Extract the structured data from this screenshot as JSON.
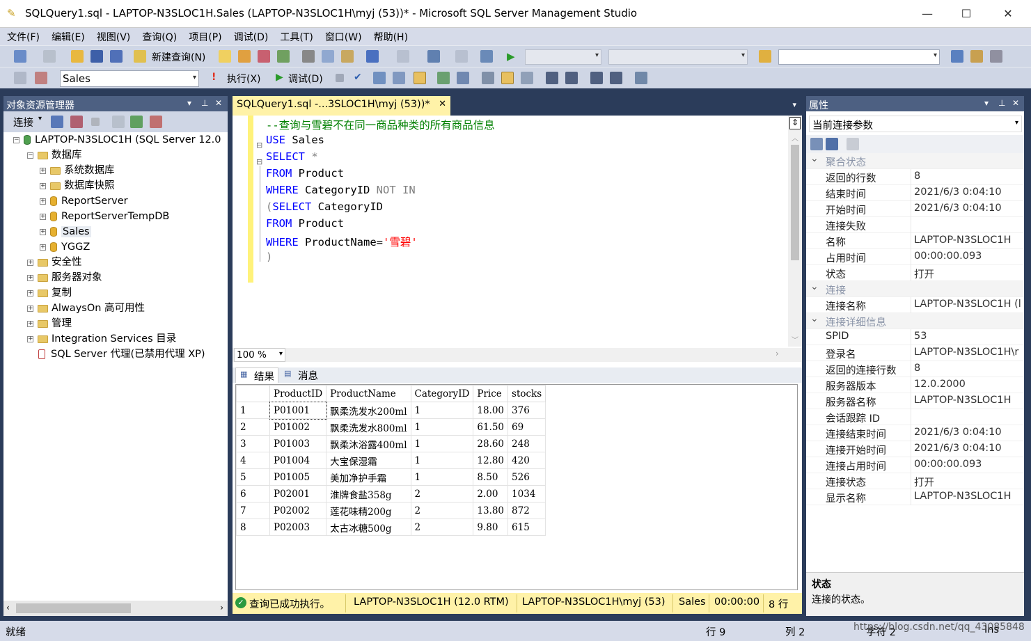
{
  "window": {
    "title": "SQLQuery1.sql - LAPTOP-N3SLOC1H.Sales (LAPTOP-N3SLOC1H\\myj (53))* - Microsoft SQL Server Management Studio"
  },
  "menu": [
    "文件(F)",
    "编辑(E)",
    "视图(V)",
    "查询(Q)",
    "项目(P)",
    "调试(D)",
    "工具(T)",
    "窗口(W)",
    "帮助(H)"
  ],
  "toolbar1": {
    "new_query": "新建查询(N)"
  },
  "toolbar2": {
    "database": "Sales",
    "execute": "执行(X)",
    "debug": "调试(D)"
  },
  "object_explorer": {
    "title": "对象资源管理器",
    "connect": "连接",
    "server": "LAPTOP-N3SLOC1H (SQL Server 12.0",
    "nodes": [
      "数据库",
      "系统数据库",
      "数据库快照",
      "ReportServer",
      "ReportServerTempDB",
      "Sales",
      "YGGZ",
      "安全性",
      "服务器对象",
      "复制",
      "AlwaysOn 高可用性",
      "管理",
      "Integration Services 目录",
      "SQL Server 代理(已禁用代理 XP)"
    ]
  },
  "editor": {
    "tab_label": "SQLQuery1.sql -...3SLOC1H\\myj (53))*",
    "lines": {
      "l1": "--查询与雪碧不在同一商品种类的所有商品信息",
      "l2_kw": "USE",
      "l2_rest": " Sales",
      "l3_kw": "SELECT",
      "l3_rest": " *",
      "l4_kw": "FROM",
      "l4_rest": " Product",
      "l5_kw": "WHERE",
      "l5_mid": " CategoryID ",
      "l5_op": "NOT IN",
      "l6_paren": "(",
      "l6_kw": "SELECT",
      "l6_rest": " CategoryID",
      "l7_kw": "FROM",
      "l7_rest": " Product",
      "l8_kw": "WHERE",
      "l8_mid": " ProductName=",
      "l8_str": "'雪碧'",
      "l9": ")"
    },
    "zoom": "100 %"
  },
  "results": {
    "tab_results": "结果",
    "tab_messages": "消息",
    "columns": [
      "ProductID",
      "ProductName",
      "CategoryID",
      "Price",
      "stocks"
    ],
    "rows": [
      [
        "1",
        "P01001",
        "飘柔洗发水200ml",
        "1",
        "18.00",
        "376"
      ],
      [
        "2",
        "P01002",
        "飘柔洗发水800ml",
        "1",
        "61.50",
        "69"
      ],
      [
        "3",
        "P01003",
        "飘柔沐浴露400ml",
        "1",
        "28.60",
        "248"
      ],
      [
        "4",
        "P01004",
        "大宝保湿霜",
        "1",
        "12.80",
        "420"
      ],
      [
        "5",
        "P01005",
        "美加净护手霜",
        "1",
        "8.50",
        "526"
      ],
      [
        "6",
        "P02001",
        "淮牌食盐358g",
        "2",
        "2.00",
        "1034"
      ],
      [
        "7",
        "P02002",
        "莲花味精200g",
        "2",
        "13.80",
        "872"
      ],
      [
        "8",
        "P02003",
        "太古冰糖500g",
        "2",
        "9.80",
        "615"
      ]
    ]
  },
  "query_status": {
    "message": "查询已成功执行。",
    "server": "LAPTOP-N3SLOC1H (12.0 RTM)",
    "user": "LAPTOP-N3SLOC1H\\myj (53)",
    "db": "Sales",
    "time": "00:00:00",
    "rows": "8 行"
  },
  "properties": {
    "title": "属性",
    "selector": "当前连接参数",
    "rows": [
      {
        "type": "cat",
        "k": "聚合状态"
      },
      {
        "k": "返回的行数",
        "v": "8"
      },
      {
        "k": "结束时间",
        "v": "2021/6/3 0:04:10"
      },
      {
        "k": "开始时间",
        "v": "2021/6/3 0:04:10"
      },
      {
        "k": "连接失败",
        "v": ""
      },
      {
        "k": "名称",
        "v": "LAPTOP-N3SLOC1H"
      },
      {
        "k": "占用时间",
        "v": "00:00:00.093"
      },
      {
        "k": "状态",
        "v": "打开"
      },
      {
        "type": "cat",
        "k": "连接"
      },
      {
        "k": "连接名称",
        "v": "LAPTOP-N3SLOC1H (l"
      },
      {
        "type": "cat",
        "k": "连接详细信息"
      },
      {
        "k": "SPID",
        "v": "53"
      },
      {
        "k": "登录名",
        "v": "LAPTOP-N3SLOC1H\\r"
      },
      {
        "k": "返回的连接行数",
        "v": "8"
      },
      {
        "k": "服务器版本",
        "v": "12.0.2000"
      },
      {
        "k": "服务器名称",
        "v": "LAPTOP-N3SLOC1H"
      },
      {
        "k": "会话跟踪 ID",
        "v": ""
      },
      {
        "k": "连接结束时间",
        "v": "2021/6/3 0:04:10"
      },
      {
        "k": "连接开始时间",
        "v": "2021/6/3 0:04:10"
      },
      {
        "k": "连接占用时间",
        "v": "00:00:00.093"
      },
      {
        "k": "连接状态",
        "v": "打开"
      },
      {
        "k": "显示名称",
        "v": "LAPTOP-N3SLOC1H"
      }
    ],
    "desc_title": "状态",
    "desc_text": "连接的状态。"
  },
  "statusbar": {
    "ready": "就绪",
    "row": "行 9",
    "col": "列 2",
    "char": "字符 2",
    "ins": "Ins",
    "watermark": "https://blog.csdn.net/qq_43085848"
  }
}
